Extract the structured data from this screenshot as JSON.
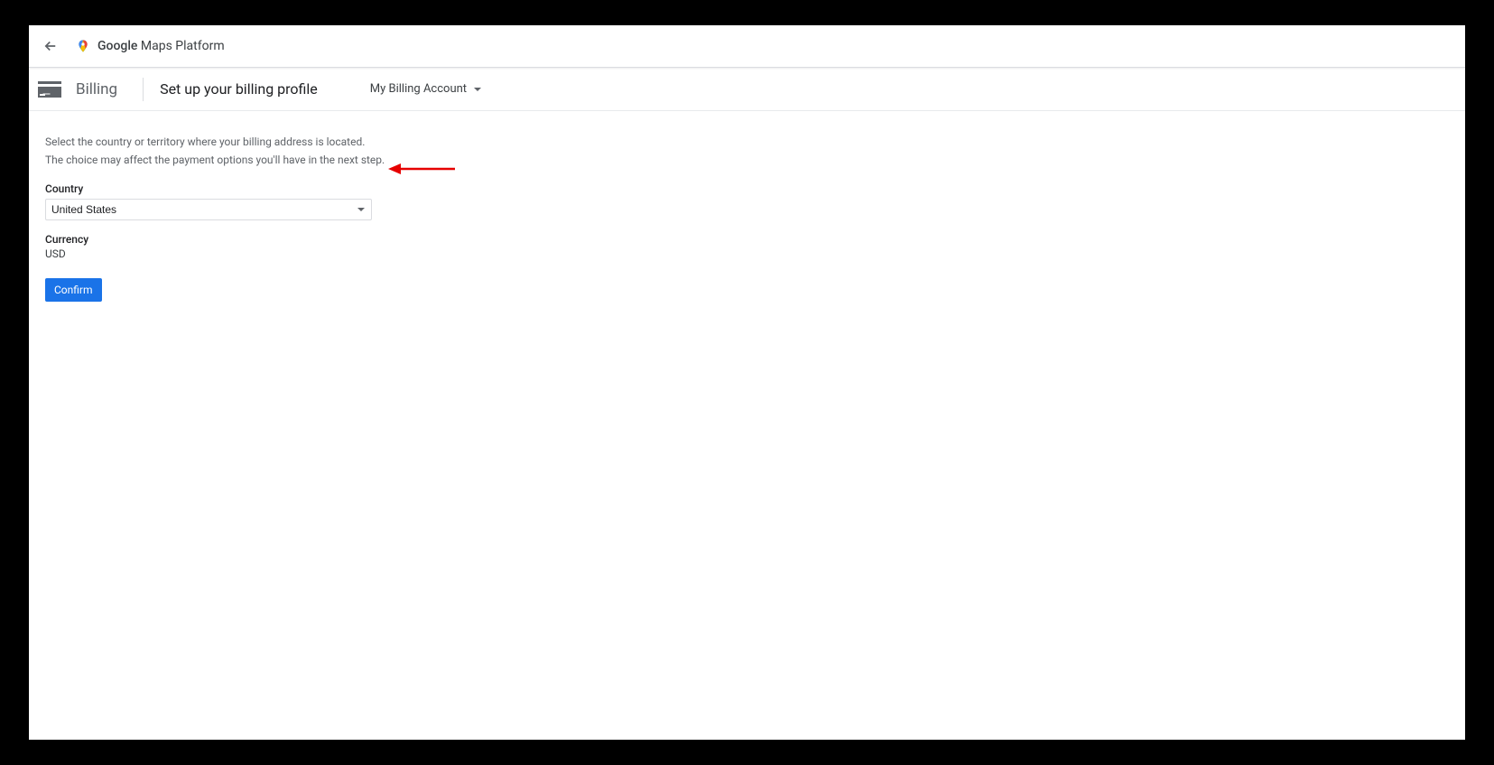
{
  "header": {
    "product_name_bold": "Google",
    "product_name_rest": " Maps Platform"
  },
  "subheader": {
    "billing_label": "Billing",
    "page_title": "Set up your billing profile",
    "account_name": "My Billing Account"
  },
  "form": {
    "helper_line1": "Select the country or territory where your billing address is located.",
    "helper_line2": "The choice may affect the payment options you'll have in the next step.",
    "country_label": "Country",
    "country_value": "United States",
    "currency_label": "Currency",
    "currency_value": "USD",
    "confirm_label": "Confirm"
  }
}
